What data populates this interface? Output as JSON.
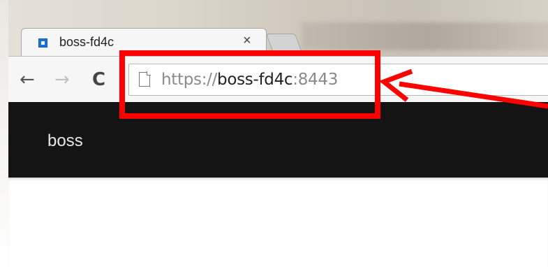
{
  "browser": {
    "tab": {
      "title": "boss-fd4c",
      "close_label": "×",
      "favicon": "square-favicon-icon"
    },
    "toolbar": {
      "back_icon": "←",
      "forward_icon": "→",
      "reload_icon": "C"
    },
    "omnibox": {
      "scheme": "https://",
      "host": "boss-fd4c",
      "port": ":8443",
      "page_icon": "document-icon"
    }
  },
  "app": {
    "brand": "boss",
    "header_color": "#141414"
  },
  "annotation": {
    "highlight_color": "#ff0000",
    "shape": "rectangle-with-arrow",
    "target": "omnibox-url"
  },
  "colors": {
    "favicon": "#1a73d9",
    "url_dim": "#8a8a8a",
    "url_host": "#222222"
  }
}
